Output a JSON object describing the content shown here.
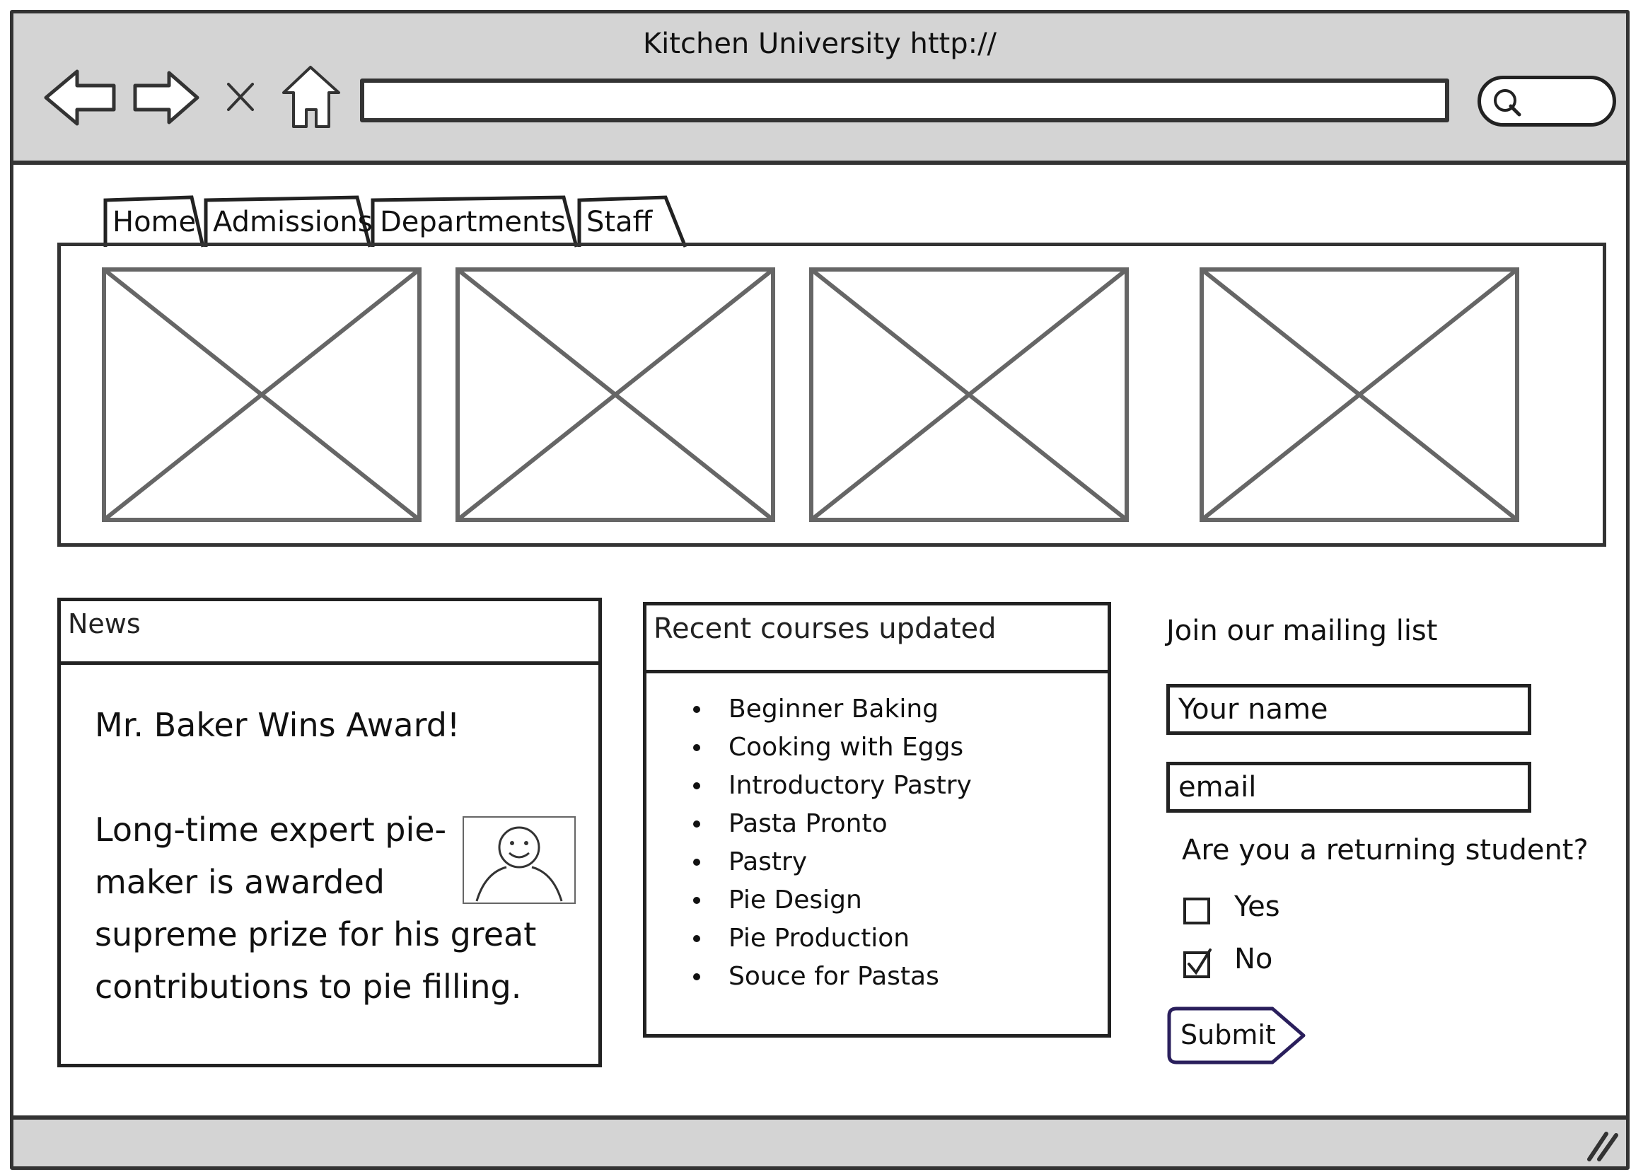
{
  "window": {
    "title": "Kitchen University http://"
  },
  "toolbar": {
    "back_icon": "back-arrow-icon",
    "forward_icon": "forward-arrow-icon",
    "stop_icon": "close-icon",
    "home_icon": "home-icon",
    "address_value": "",
    "search_icon": "search-icon"
  },
  "tabs": [
    {
      "label": "Home"
    },
    {
      "label": "Admissions"
    },
    {
      "label": "Departments"
    },
    {
      "label": "Staff"
    }
  ],
  "banner": {
    "image_count": 4
  },
  "news": {
    "heading": "News",
    "headline": "Mr. Baker Wins Award!",
    "body": "Long-time expert pie-maker is awarded supreme prize for his great contributions to pie filling.",
    "image_icon": "avatar-icon"
  },
  "courses": {
    "heading": "Recent courses updated",
    "items": [
      "Beginner Baking",
      "Cooking with Eggs",
      "Introductory Pastry",
      "Pasta Pronto",
      "Pastry",
      "Pie Design",
      "Pie Production",
      "Souce for Pastas"
    ]
  },
  "mailing": {
    "title": "Join our mailing list",
    "name_value": "Your name",
    "email_value": "email",
    "question": "Are you a returning student?",
    "options": [
      {
        "label": "Yes",
        "checked": false
      },
      {
        "label": "No",
        "checked": true
      }
    ],
    "submit_label": "Submit"
  },
  "colors": {
    "chrome": "#d4d4d4",
    "stroke": "#333333",
    "submit_outline": "#2a1f5c"
  }
}
